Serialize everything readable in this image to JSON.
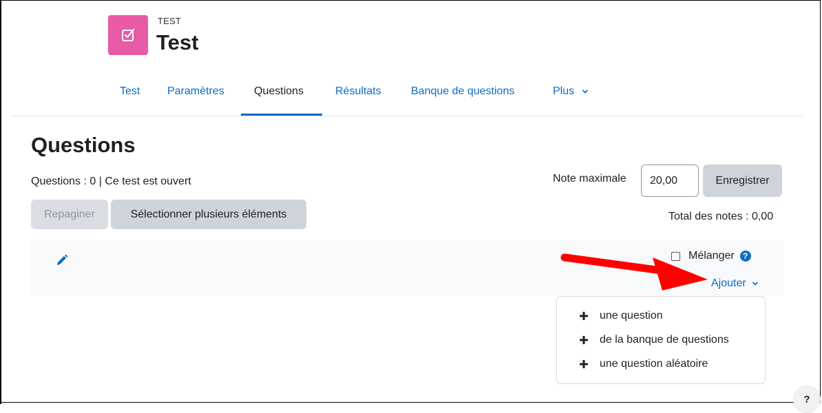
{
  "header": {
    "kicker": "TEST",
    "title": "Test",
    "icon": "quiz-checkbox-icon",
    "icon_color": "#e85aa5"
  },
  "tabs": [
    {
      "label": "Test"
    },
    {
      "label": "Paramètres"
    },
    {
      "label": "Questions",
      "active": true
    },
    {
      "label": "Résultats"
    },
    {
      "label": "Banque de questions"
    },
    {
      "label": "Plus"
    }
  ],
  "main": {
    "heading": "Questions",
    "status": "Questions : 0 | Ce test est ouvert",
    "repaginate_label": "Repaginer",
    "select_multiple_label": "Sélectionner plusieurs éléments",
    "max_grade_label": "Note maximale",
    "max_grade_value": "20,00",
    "save_label": "Enregistrer",
    "total_label": "Total des notes : 0,00"
  },
  "section": {
    "shuffle_label": "Mélanger",
    "add_label": "Ajouter",
    "add_menu": [
      {
        "label": "une question"
      },
      {
        "label": "de la banque de questions"
      },
      {
        "label": "une question aléatoire"
      }
    ]
  },
  "help_fab": "?",
  "colors": {
    "link": "#0f6cbf",
    "button_bg": "#ced4da",
    "section_bg": "#f8f9fa",
    "annotation_arrow": "#ff0000"
  }
}
